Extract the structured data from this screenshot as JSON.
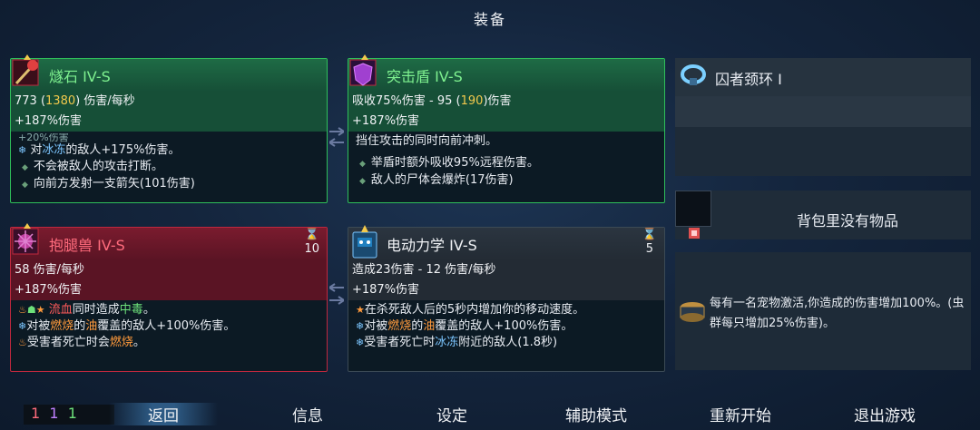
{
  "header": {
    "title": "装备"
  },
  "cards": {
    "c1": {
      "name": "燧石 IV-S",
      "stat1_a": "773 (",
      "stat1_hl": "1380",
      "stat1_b": ") 伤害/每秒",
      "stat2": "+187%伤害",
      "faded": "+20%伤害",
      "line1_pre": "对",
      "line1_hl": "冰冻",
      "line1_post": "的敌人+175%伤害。",
      "line2": "不会被敌人的攻击打断。",
      "line3": "向前方发射一支箭矢(101伤害)"
    },
    "c2": {
      "name": "突击盾 IV-S",
      "stat1_a": "吸收75%伤害 - 95 (",
      "stat1_hl": "190",
      "stat1_b": ")伤害",
      "stat2": "+187%伤害",
      "line1": "挡住攻击的同时向前冲刺。",
      "line2": "举盾时额外吸收95%远程伤害。",
      "line3": "敌人的尸体会爆炸(17伤害)"
    },
    "c3": {
      "name": "抱腿兽 IV-S",
      "cooldown": "10",
      "stat1": "58 伤害/每秒",
      "stat2": "+187%伤害",
      "line1_a": "流血",
      "line1_b": "同时造成",
      "line1_c": "中毒",
      "line1_d": "。",
      "line2_a": "对被",
      "line2_b": "燃烧",
      "line2_c": "的",
      "line2_d": "油",
      "line2_e": "覆盖的敌人+100%伤害。",
      "line3_a": "受害者死亡时会",
      "line3_b": "燃烧",
      "line3_c": "。"
    },
    "c4": {
      "name": "电动力学 IV-S",
      "cooldown": "5",
      "stat1": "造成23伤害 - 12 伤害/每秒",
      "stat2": "+187%伤害",
      "line1": "在杀死敌人后的5秒内增加你的移动速度。",
      "line2_a": "对被",
      "line2_b": "燃烧",
      "line2_c": "的",
      "line2_d": "油",
      "line2_e": "覆盖的敌人+100%伤害。",
      "line3_a": "受害者死亡时",
      "line3_b": "冰冻",
      "line3_c": "附近的敌人(1.8秒)"
    }
  },
  "amulet": {
    "name": "囚者颈环 I"
  },
  "backpack": {
    "empty_text": "背包里没有物品"
  },
  "pet": {
    "text": "每有一名宠物激活,你造成的伤害增加100%。(虫群每只增加25%伤害)。"
  },
  "counter": {
    "a": "1",
    "b": "1",
    "c": "1"
  },
  "menu": {
    "back": "返回",
    "info": "信息",
    "settings": "设定",
    "assist": "辅助模式",
    "restart": "重新开始",
    "quit": "退出游戏"
  },
  "colors": {
    "green_border": "#2fbf5a",
    "red_border": "#c0283e",
    "highlight": "#f2c94c",
    "freeze": "#7cc6ff",
    "burn": "#ff9a3c"
  }
}
